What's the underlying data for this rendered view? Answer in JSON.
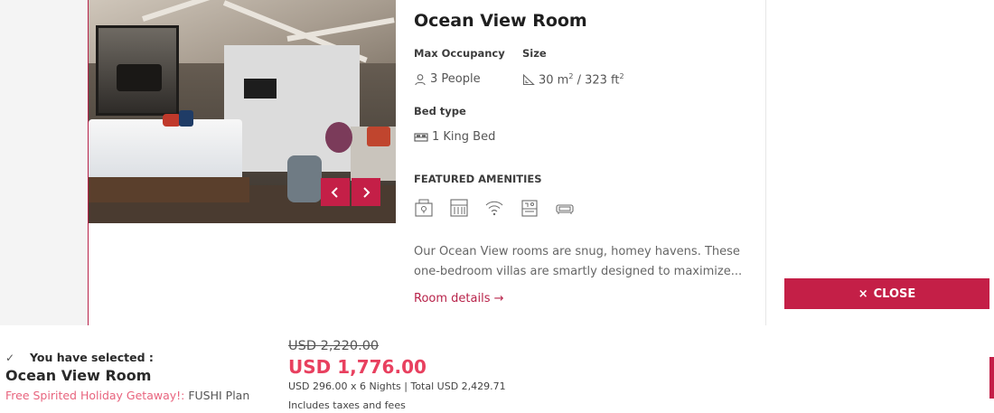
{
  "room": {
    "title": "Ocean View Room",
    "max_occupancy_label": "Max Occupancy",
    "occupancy_value": "3 People",
    "size_label": "Size",
    "size_m2": "30 m",
    "size_sep": " / 323 ft",
    "sup": "2",
    "bed_type_label": "Bed type",
    "bed_value": "1 King Bed",
    "featured_amenities_label": "FEATURED AMENITIES",
    "amenities": [
      "safe-icon",
      "minibar-icon",
      "wifi-icon",
      "bathtub-icon",
      "sofa-icon"
    ],
    "description": "Our Ocean View rooms are snug, homey havens. These one-bedroom villas are smartly designed to maximize...",
    "details_link": "Room details →"
  },
  "gallery": {
    "prev_icon": "chevron-left-icon",
    "next_icon": "chevron-right-icon"
  },
  "close_button": {
    "icon": "×",
    "label": "CLOSE"
  },
  "selection": {
    "check": "✓",
    "label": "You have selected :",
    "room": "Ocean View Room",
    "plan_prefix": "Free Spirited Holiday Getaway!:",
    "plan_name": " FUSHI Plan"
  },
  "pricing": {
    "original": "USD 2,220.00",
    "current": "USD 1,776.00",
    "breakdown": "USD 296.00 x 6 Nights | Total  USD 2,429.71",
    "tax_note": "Includes taxes and fees"
  },
  "colors": {
    "accent": "#c41f47",
    "price": "#e8405f",
    "plan": "#e8647e"
  }
}
